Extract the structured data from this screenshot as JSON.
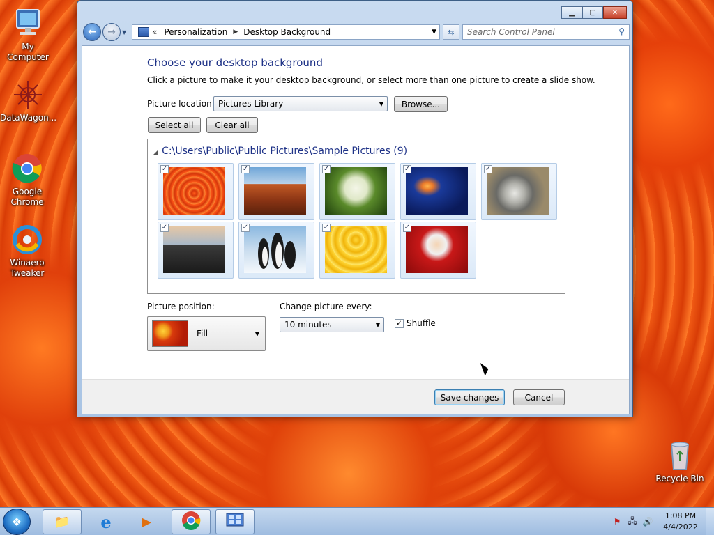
{
  "desktop": {
    "icons": [
      {
        "label": "My Computer"
      },
      {
        "label": "DataWagon..."
      },
      {
        "label": "Google Chrome"
      },
      {
        "label": "Winaero Tweaker"
      },
      {
        "label": "Recycle Bin"
      }
    ]
  },
  "window": {
    "address": {
      "overflow": "«",
      "crumbs": [
        "Personalization",
        "Desktop Background"
      ]
    },
    "search_placeholder": "Search Control Panel",
    "heading": "Choose your desktop background",
    "subtext": "Click a picture to make it your desktop background, or select more than one picture to create a slide show.",
    "picture_location": {
      "label": "Picture location:",
      "value": "Pictures Library",
      "browse": "Browse..."
    },
    "select_all": "Select all",
    "clear_all": "Clear all",
    "gallery": {
      "group_title": "C:\\Users\\Public\\Public Pictures\\Sample Pictures (9)",
      "pictures": [
        {
          "name": "chrysanthemum",
          "checked": true
        },
        {
          "name": "desert",
          "checked": true
        },
        {
          "name": "hydrangeas",
          "checked": true
        },
        {
          "name": "jellyfish",
          "checked": true
        },
        {
          "name": "koala",
          "checked": true
        },
        {
          "name": "lighthouse",
          "checked": true
        },
        {
          "name": "penguins",
          "checked": true
        },
        {
          "name": "tulips",
          "checked": true
        },
        {
          "name": "santa",
          "checked": true
        }
      ]
    },
    "picture_position": {
      "label": "Picture position:",
      "value": "Fill"
    },
    "change_every": {
      "label": "Change picture every:",
      "value": "10 minutes"
    },
    "shuffle": {
      "label": "Shuffle",
      "checked": true
    },
    "save": "Save changes",
    "cancel": "Cancel"
  },
  "taskbar": {
    "clock_time": "1:08 PM",
    "clock_date": "4/4/2022"
  }
}
